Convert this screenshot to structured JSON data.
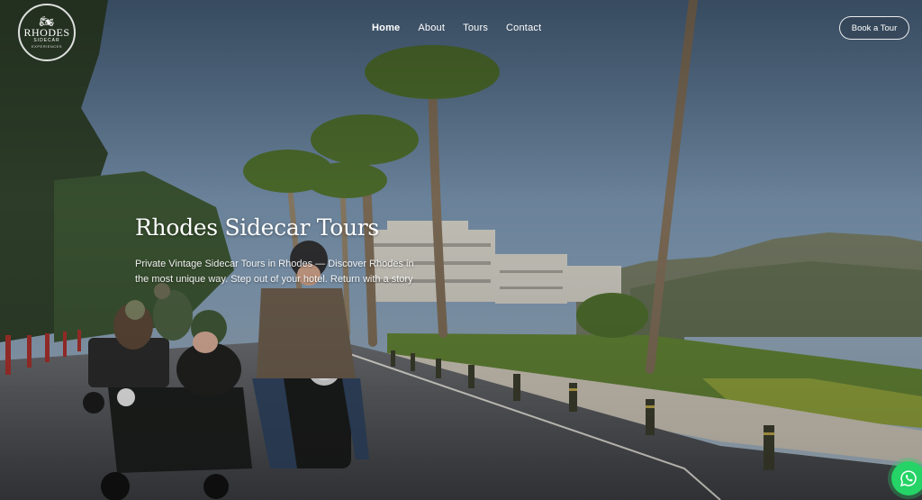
{
  "brand": {
    "line1": "RHODES",
    "line2": "SIDECAR",
    "line3": "EXPERIENCES"
  },
  "nav": {
    "items": [
      "Home",
      "About",
      "Tours",
      "Contact"
    ],
    "active": "Home"
  },
  "cta": {
    "book_label": "Book a Tour"
  },
  "hero": {
    "title": "Rhodes Sidecar Tours",
    "subtitle": "Private Vintage Sidecar Tours in Rhodes — Discover Rhodes in the most unique way. Step out of your hotel. Return with a story"
  },
  "icons": {
    "logo": "motorcycle-logo-icon",
    "chat": "whatsapp-icon"
  },
  "colors": {
    "sky": "#6d87a1",
    "whatsapp": "#25d366",
    "text": "#ffffff"
  }
}
